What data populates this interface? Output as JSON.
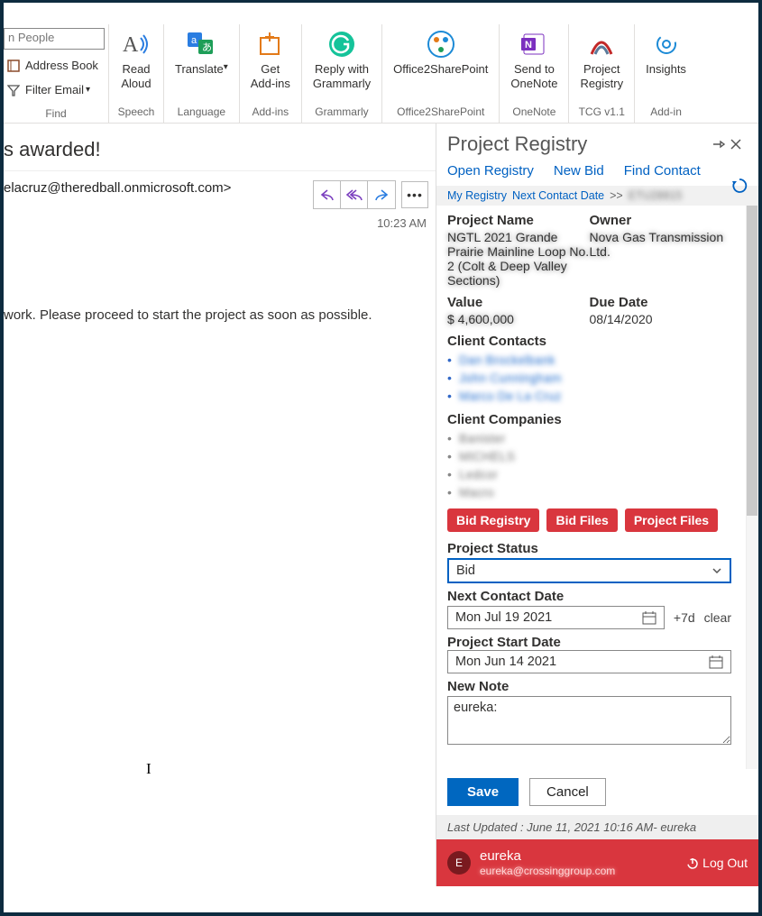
{
  "ribbon": {
    "search_placeholder": "People",
    "address_book": "Address Book",
    "filter_email": "Filter Email",
    "group_find": "Find",
    "read_aloud": "Read\nAloud",
    "group_speech": "Speech",
    "translate": "Translate",
    "group_language": "Language",
    "get_addins": "Get\nAdd-ins",
    "group_addins": "Add-ins",
    "reply_grammarly": "Reply with\nGrammarly",
    "group_grammarly": "Grammarly",
    "office2sp": "Office2SharePoint",
    "group_office2sp": "Office2SharePoint",
    "send_onenote": "Send to\nOneNote",
    "group_onenote": "OneNote",
    "project_registry": "Project\nRegistry",
    "group_tcg": "TCG v1.1",
    "insights": "Insights",
    "group_addin": "Add-in"
  },
  "mail": {
    "subject": "s awarded!",
    "from": "elacruz@theredball.onmicrosoft.com>",
    "time": "10:23 AM",
    "body": "work. Please proceed to start the project as soon as possible."
  },
  "pane": {
    "title": "Project Registry",
    "links": {
      "open": "Open Registry",
      "new_bid": "New Bid",
      "find": "Find Contact"
    },
    "breadcrumb": {
      "a": "My Registry",
      "b": "Next Contact Date",
      "sep": ">>",
      "cur": "ETU28815"
    },
    "labels": {
      "project_name": "Project Name",
      "owner": "Owner",
      "value": "Value",
      "due_date": "Due Date",
      "client_contacts": "Client Contacts",
      "client_companies": "Client Companies",
      "project_status": "Project Status",
      "next_contact": "Next Contact Date",
      "project_start": "Project Start Date",
      "new_note": "New Note"
    },
    "project_name_value": "NGTL 2021 Grande Prairie Mainline Loop No. 2 (Colt & Deep Valley Sections)",
    "owner_value": "Nova Gas Transmission Ltd.",
    "value_amount": "$ 4,600,000",
    "due_date_value": "08/14/2020",
    "contacts": [
      "Dan Brockelbank",
      "John Cunningham",
      "Marco De La Cruz"
    ],
    "companies": [
      "Banister",
      "MICHELS",
      "Ledcor",
      "Macro"
    ],
    "red_buttons": {
      "bid_registry": "Bid Registry",
      "bid_files": "Bid Files",
      "project_files": "Project Files"
    },
    "status_value": "Bid",
    "next_contact_value": "Mon Jul 19 2021",
    "plus7": "+7d",
    "clear": "clear",
    "project_start_value": "Mon Jun 14 2021",
    "note_value": "eureka:",
    "save": "Save",
    "cancel": "Cancel",
    "last_updated": "Last Updated : June 11, 2021 10:16 AM- eureka",
    "user": {
      "initial": "E",
      "name": "eureka",
      "email": "eureka@crossinggroup.com"
    },
    "logout": "Log Out"
  }
}
